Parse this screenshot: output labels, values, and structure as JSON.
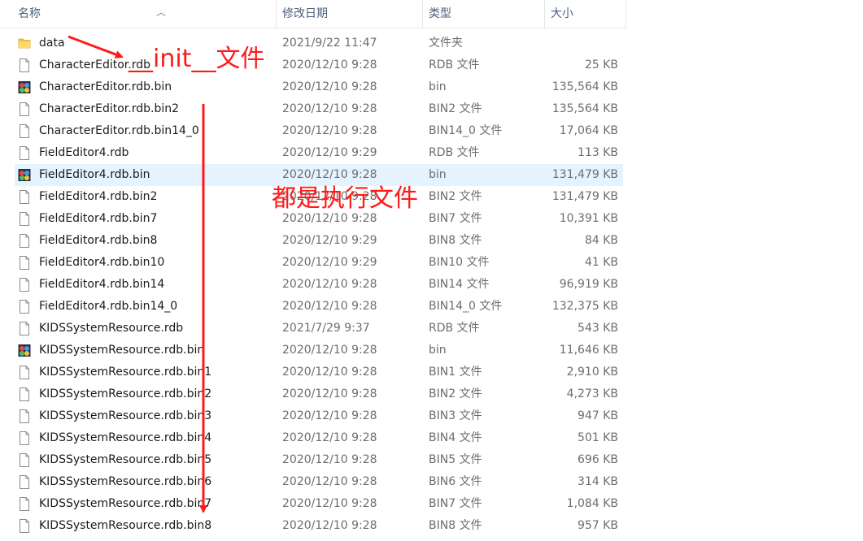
{
  "columns": {
    "name": "名称",
    "date": "修改日期",
    "type": "类型",
    "size": "大小"
  },
  "rows": [
    {
      "name": "data",
      "date": "2021/9/22 11:47",
      "type": "文件夹",
      "size": "",
      "icon": "folder-icon"
    },
    {
      "name": "CharacterEditor.rdb",
      "date": "2020/12/10 9:28",
      "type": "RDB 文件",
      "size": "25 KB",
      "icon": "file-icon"
    },
    {
      "name": "CharacterEditor.rdb.bin",
      "date": "2020/12/10 9:28",
      "type": "bin",
      "size": "135,564 KB",
      "icon": "app-icon"
    },
    {
      "name": "CharacterEditor.rdb.bin2",
      "date": "2020/12/10 9:28",
      "type": "BIN2 文件",
      "size": "135,564 KB",
      "icon": "file-icon"
    },
    {
      "name": "CharacterEditor.rdb.bin14_0",
      "date": "2020/12/10 9:28",
      "type": "BIN14_0 文件",
      "size": "17,064 KB",
      "icon": "file-icon"
    },
    {
      "name": "FieldEditor4.rdb",
      "date": "2020/12/10 9:29",
      "type": "RDB 文件",
      "size": "113 KB",
      "icon": "file-icon"
    },
    {
      "name": "FieldEditor4.rdb.bin",
      "date": "2020/12/10 9:28",
      "type": "bin",
      "size": "131,479 KB",
      "icon": "app-icon",
      "selected": true
    },
    {
      "name": "FieldEditor4.rdb.bin2",
      "date": "2020/12/10 9:28",
      "type": "BIN2 文件",
      "size": "131,479 KB",
      "icon": "file-icon"
    },
    {
      "name": "FieldEditor4.rdb.bin7",
      "date": "2020/12/10 9:28",
      "type": "BIN7 文件",
      "size": "10,391 KB",
      "icon": "file-icon"
    },
    {
      "name": "FieldEditor4.rdb.bin8",
      "date": "2020/12/10 9:29",
      "type": "BIN8 文件",
      "size": "84 KB",
      "icon": "file-icon"
    },
    {
      "name": "FieldEditor4.rdb.bin10",
      "date": "2020/12/10 9:29",
      "type": "BIN10 文件",
      "size": "41 KB",
      "icon": "file-icon"
    },
    {
      "name": "FieldEditor4.rdb.bin14",
      "date": "2020/12/10 9:28",
      "type": "BIN14 文件",
      "size": "96,919 KB",
      "icon": "file-icon"
    },
    {
      "name": "FieldEditor4.rdb.bin14_0",
      "date": "2020/12/10 9:28",
      "type": "BIN14_0 文件",
      "size": "132,375 KB",
      "icon": "file-icon"
    },
    {
      "name": "KIDSSystemResource.rdb",
      "date": "2021/7/29 9:37",
      "type": "RDB 文件",
      "size": "543 KB",
      "icon": "file-icon"
    },
    {
      "name": "KIDSSystemResource.rdb.bin",
      "date": "2020/12/10 9:28",
      "type": "bin",
      "size": "11,646 KB",
      "icon": "app-icon"
    },
    {
      "name": "KIDSSystemResource.rdb.bin1",
      "date": "2020/12/10 9:28",
      "type": "BIN1 文件",
      "size": "2,910 KB",
      "icon": "file-icon"
    },
    {
      "name": "KIDSSystemResource.rdb.bin2",
      "date": "2020/12/10 9:28",
      "type": "BIN2 文件",
      "size": "4,273 KB",
      "icon": "file-icon"
    },
    {
      "name": "KIDSSystemResource.rdb.bin3",
      "date": "2020/12/10 9:28",
      "type": "BIN3 文件",
      "size": "947 KB",
      "icon": "file-icon"
    },
    {
      "name": "KIDSSystemResource.rdb.bin4",
      "date": "2020/12/10 9:28",
      "type": "BIN4 文件",
      "size": "501 KB",
      "icon": "file-icon"
    },
    {
      "name": "KIDSSystemResource.rdb.bin5",
      "date": "2020/12/10 9:28",
      "type": "BIN5 文件",
      "size": "696 KB",
      "icon": "file-icon"
    },
    {
      "name": "KIDSSystemResource.rdb.bin6",
      "date": "2020/12/10 9:28",
      "type": "BIN6 文件",
      "size": "314 KB",
      "icon": "file-icon"
    },
    {
      "name": "KIDSSystemResource.rdb.bin7",
      "date": "2020/12/10 9:28",
      "type": "BIN7 文件",
      "size": "1,084 KB",
      "icon": "file-icon"
    },
    {
      "name": "KIDSSystemResource.rdb.bin8",
      "date": "2020/12/10 9:28",
      "type": "BIN8 文件",
      "size": "957 KB",
      "icon": "file-icon"
    }
  ],
  "annotations": {
    "init_label": "__init__文件",
    "exec_label": "都是执行文件",
    "color": "#ff1a1a"
  },
  "colors": {
    "selected_row": "#e5f3ff",
    "folder": "#f6c14b",
    "header_text": "#4c607a"
  }
}
